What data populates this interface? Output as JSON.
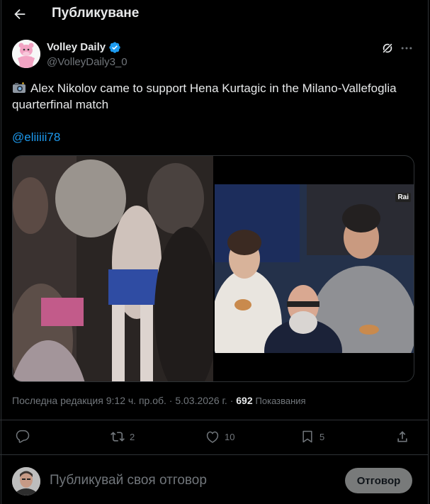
{
  "header": {
    "title": "Публикуване"
  },
  "post": {
    "author_name": "Volley Daily",
    "handle": "@VolleyDaily3_0",
    "text": "Alex Nikolov came to support Hena Kurtagic in the Milano-Vallefoglia quarterfinal match",
    "mention": "@eliiiii78",
    "rai_logo": "Rai"
  },
  "meta": {
    "edited": "Последна редакция 9:12 ч. пр.об.",
    "separator": " · ",
    "date": "5.03.2026 г.",
    "views_count": "692",
    "views_label": "Показвания"
  },
  "actions": {
    "replies": "",
    "reposts": "2",
    "likes": "10",
    "bookmarks": "5"
  },
  "reply": {
    "placeholder": "Публикувай своя отговор",
    "button_label": "Отговор"
  },
  "colors": {
    "background": "#000000",
    "text": "#e7e9ea",
    "muted": "#71767b",
    "accent": "#1d9bf0",
    "divider": "#2f3336"
  },
  "icons": [
    "back-arrow-icon",
    "verified-icon",
    "grok-icon",
    "more-icon",
    "camera-icon",
    "reply-icon",
    "repost-icon",
    "like-icon",
    "bookmark-icon",
    "share-icon"
  ]
}
